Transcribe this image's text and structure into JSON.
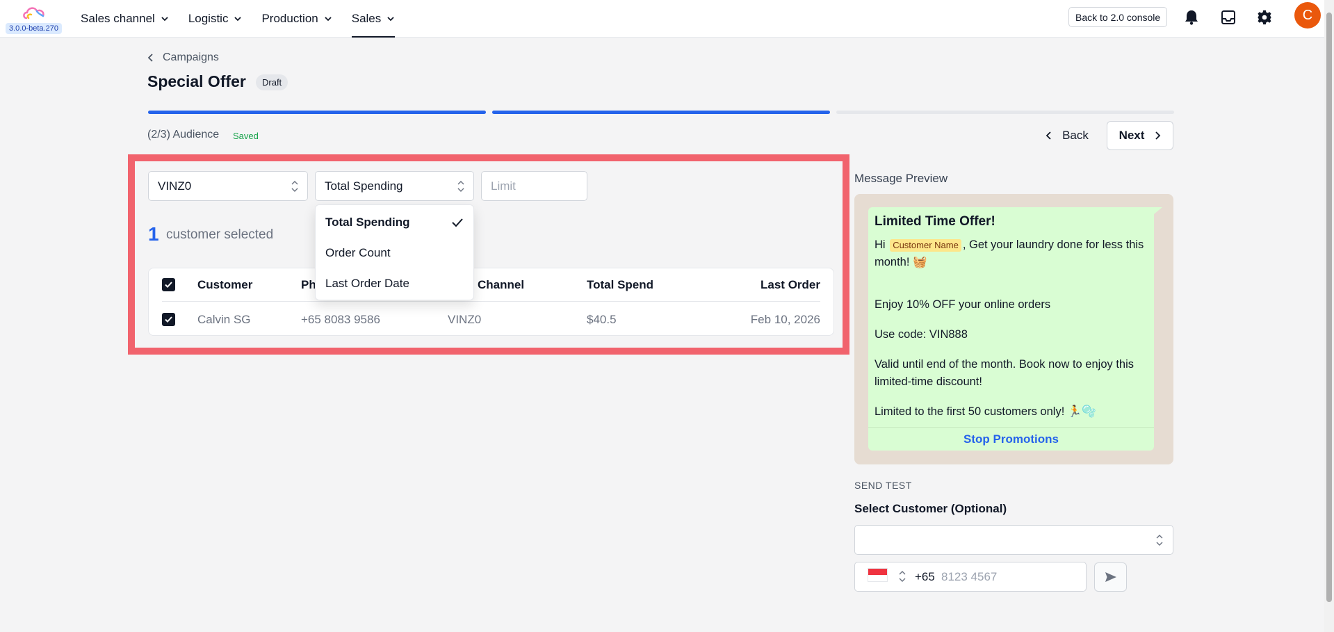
{
  "app": {
    "version": "3.0.0-beta.270",
    "avatar_initial": "C"
  },
  "nav": {
    "items": [
      {
        "label": "Sales channel"
      },
      {
        "label": "Logistic"
      },
      {
        "label": "Production"
      },
      {
        "label": "Sales"
      }
    ],
    "active": "Sales",
    "console_button": "Back to 2.0 console"
  },
  "header": {
    "breadcrumb": "Campaigns",
    "title": "Special Offer",
    "status_badge": "Draft",
    "step_label": "(2/3) Audience",
    "saved_label": "Saved",
    "back_label": "Back",
    "next_label": "Next",
    "progress": {
      "completed_steps": 2,
      "total_steps": 3
    }
  },
  "audience": {
    "channel_select": "VINZ0",
    "sort_select": "Total Spending",
    "limit_placeholder": "Limit",
    "selected_count": "1",
    "selected_label": "customer selected",
    "sort_options": [
      {
        "label": "Total Spending",
        "selected": true
      },
      {
        "label": "Order Count",
        "selected": false
      },
      {
        "label": "Last Order Date",
        "selected": false
      }
    ],
    "table": {
      "columns": [
        "Customer",
        "Ph",
        "Channel",
        "Total Spend",
        "Last Order"
      ],
      "rows": [
        {
          "customer": "Calvin SG",
          "phone": "+65 8083 9586",
          "channel": "VINZ0",
          "total_spend": "$40.5",
          "last_order": "Feb 10, 2026",
          "checked": true
        }
      ]
    }
  },
  "preview": {
    "label": "Message Preview",
    "title": "Limited Time Offer!",
    "greeting_prefix": "Hi",
    "variable_chip": "Customer Name",
    "greeting_suffix": ", Get your laundry done for less this month! 🧺",
    "line1": "Enjoy 10% OFF your online orders",
    "line2": "Use code: VIN888",
    "line3": "Valid until end of the month. Book now to enjoy this limited-time discount!",
    "line4": "Limited to the first 50 customers only! 🏃🫧",
    "stop_link": "Stop Promotions"
  },
  "send_test": {
    "section_label": "SEND TEST",
    "customer_label": "Select Customer (Optional)",
    "customer_value": "",
    "country_code": "+65",
    "phone_placeholder": "8123 4567"
  },
  "colors": {
    "accent": "#2563eb",
    "highlight": "#f1636d",
    "avatar": "#ea580c",
    "bubble": "#d9fdd3",
    "saved": "#16a34a"
  }
}
